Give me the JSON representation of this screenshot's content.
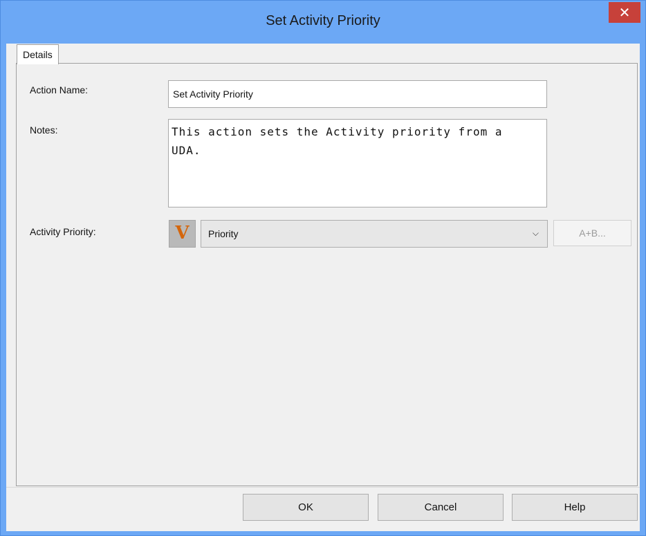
{
  "window": {
    "title": "Set Activity Priority",
    "close_glyph": "✕"
  },
  "tabs": [
    {
      "label": "Details",
      "selected": true
    }
  ],
  "form": {
    "action_name": {
      "label": "Action Name:",
      "value": "Set Activity Priority"
    },
    "notes": {
      "label": "Notes:",
      "value": "This action sets the Activity priority from a\nUDA."
    },
    "activity_priority": {
      "label": "Activity Priority:",
      "icon": "variable-icon",
      "icon_glyph": "V",
      "selected_value": "Priority",
      "expression_button": "A+B..."
    }
  },
  "buttons": {
    "ok": "OK",
    "cancel": "Cancel",
    "help": "Help"
  },
  "colors": {
    "titlebar": "#6ca8f5",
    "close_button": "#c7413a",
    "variable_icon_glyph": "#d4660c"
  }
}
